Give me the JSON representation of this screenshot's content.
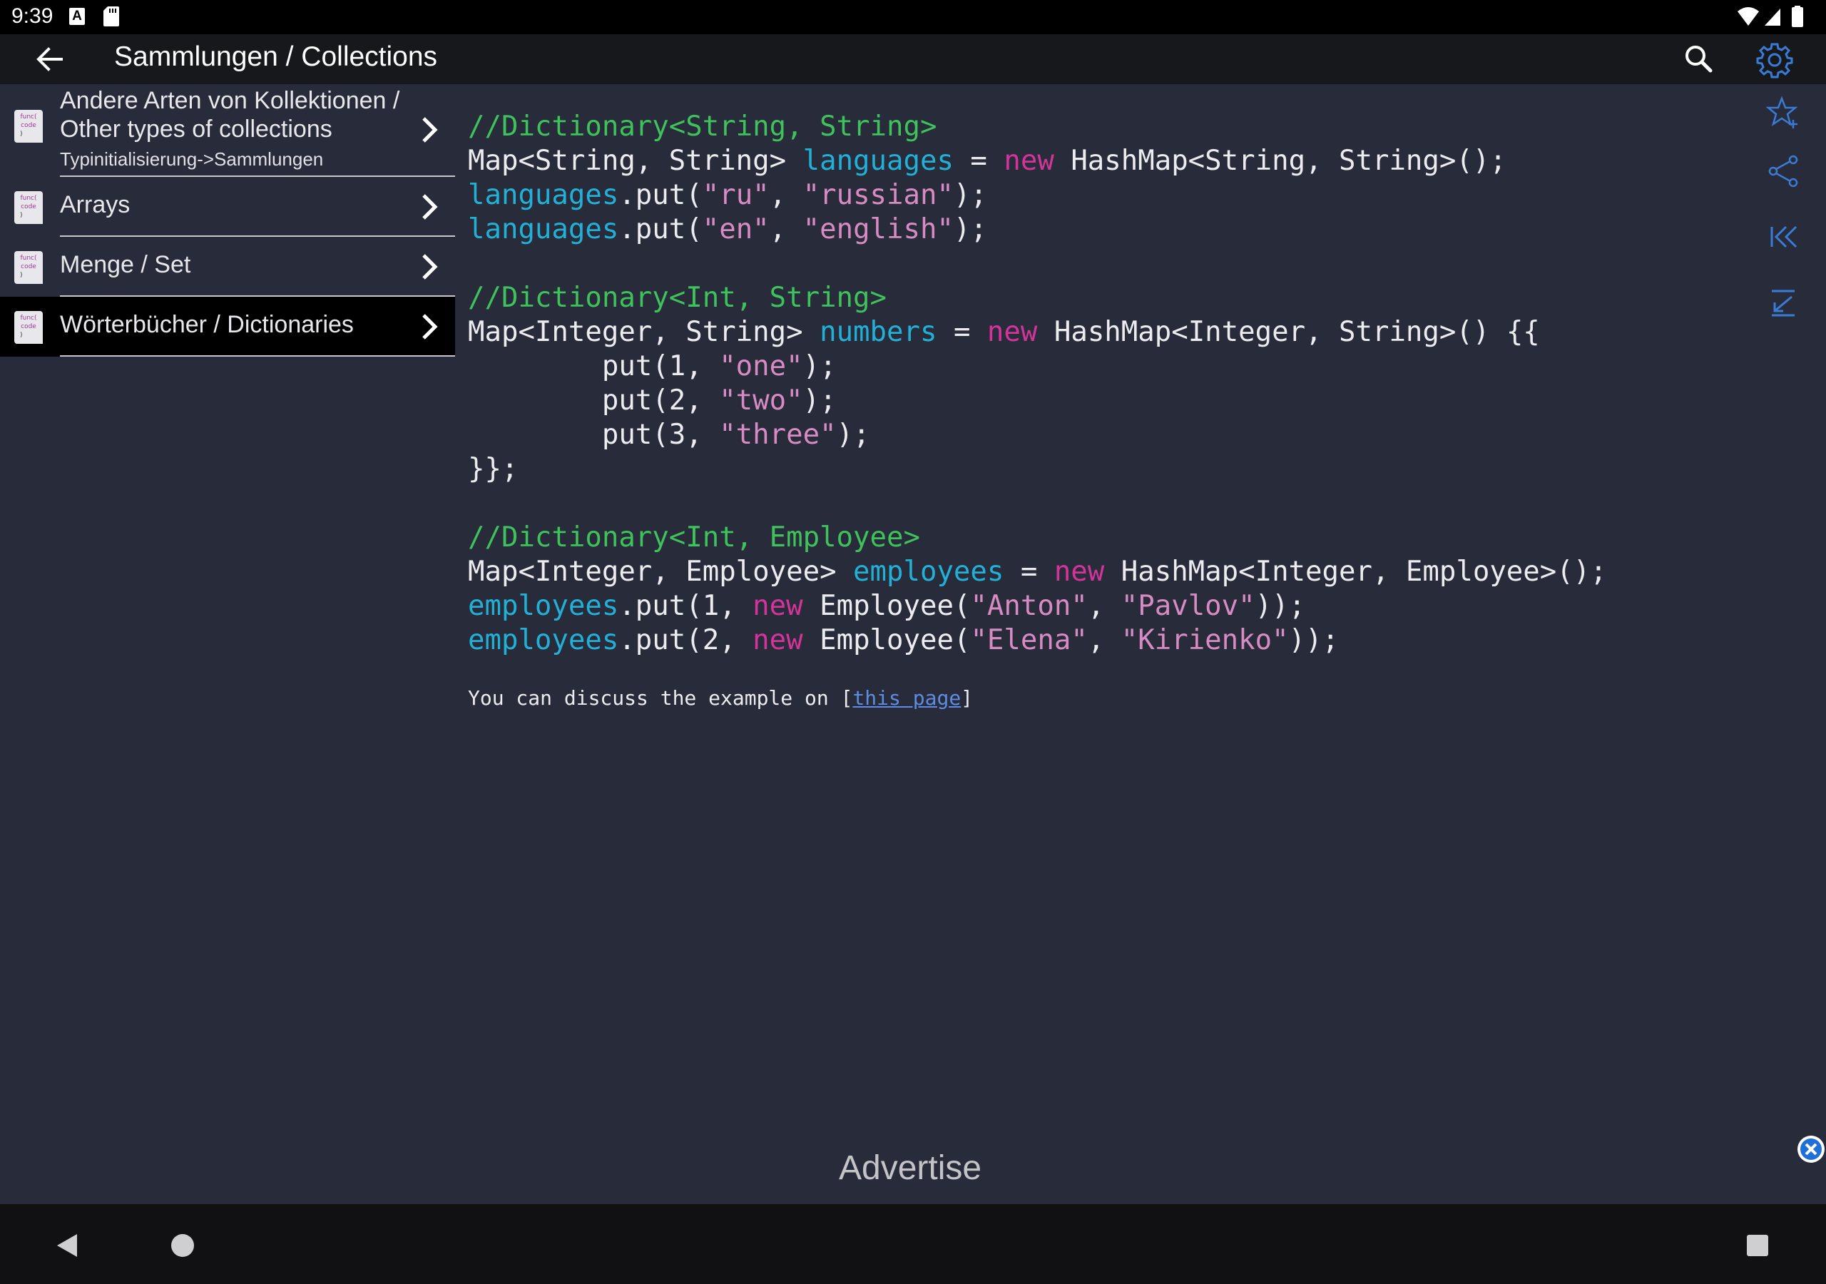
{
  "status_bar": {
    "time": "9:39",
    "a_badge": "A"
  },
  "app_bar": {
    "title": "Sammlungen / Collections"
  },
  "sidebar": {
    "items": [
      {
        "label_line1": "Andere Arten von Kollektionen /",
        "label_line2": "Other types of collections",
        "sublabel": "Typinitialisierung->Sammlungen"
      },
      {
        "label": "Arrays"
      },
      {
        "label": "Menge / Set"
      },
      {
        "label": "Wörterbücher / Dictionaries"
      }
    ],
    "file_icon_text": [
      "func(",
      "code",
      ")"
    ]
  },
  "code": {
    "comment1": "//Dictionary<String, String>",
    "comment2": "//Dictionary<Int, String>",
    "comment3": "//Dictionary<Int, Employee>"
  },
  "discuss": {
    "prefix": "You can discuss the example on ",
    "link": "this page"
  },
  "ad": {
    "label": "Advertise"
  },
  "colors": {
    "comment": "#3fc15c",
    "variable": "#22b0d6",
    "keyword": "#d2359a",
    "string": "#d68cc2",
    "accent": "#3a7bd5"
  },
  "icons": [
    "back-arrow-icon",
    "search-icon",
    "gear-icon",
    "star-add-icon",
    "share-icon",
    "skip-to-start-icon",
    "download-to-bottom-icon",
    "close-icon"
  ]
}
